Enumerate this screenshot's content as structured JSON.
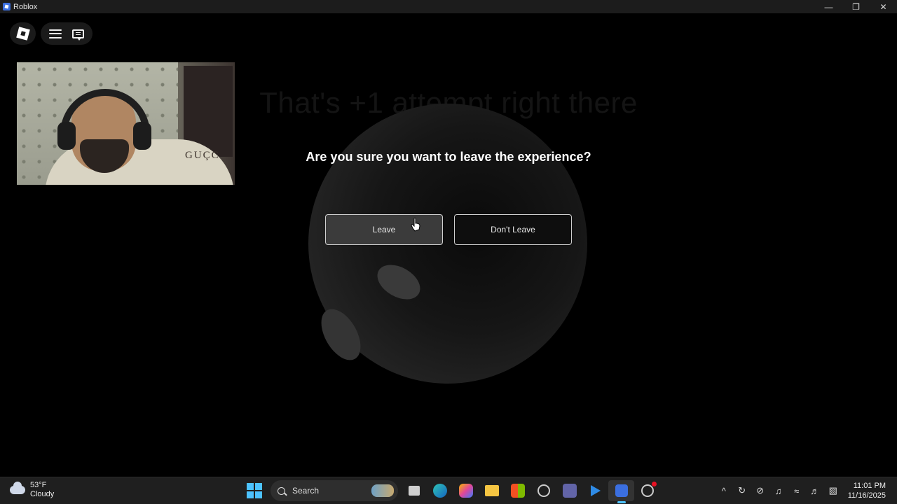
{
  "window": {
    "title": "Roblox",
    "controls": [
      "minimize",
      "restore",
      "close"
    ]
  },
  "game": {
    "background_headline": "That's +1 attempt right there",
    "dialog": {
      "question": "Are you sure you want to leave the experience?",
      "leave_label": "Leave",
      "dont_leave_label": "Don't Leave"
    }
  },
  "webcam": {
    "watermark": "GUÇC"
  },
  "taskbar": {
    "weather": {
      "temp": "53°F",
      "condition": "Cloudy"
    },
    "search_label": "Search",
    "clock": {
      "time": "11:01 PM",
      "date": "11/16/2025"
    }
  },
  "colors": {
    "accent": "#4cc2ff",
    "roblox_blue": "#3b6fe0"
  }
}
